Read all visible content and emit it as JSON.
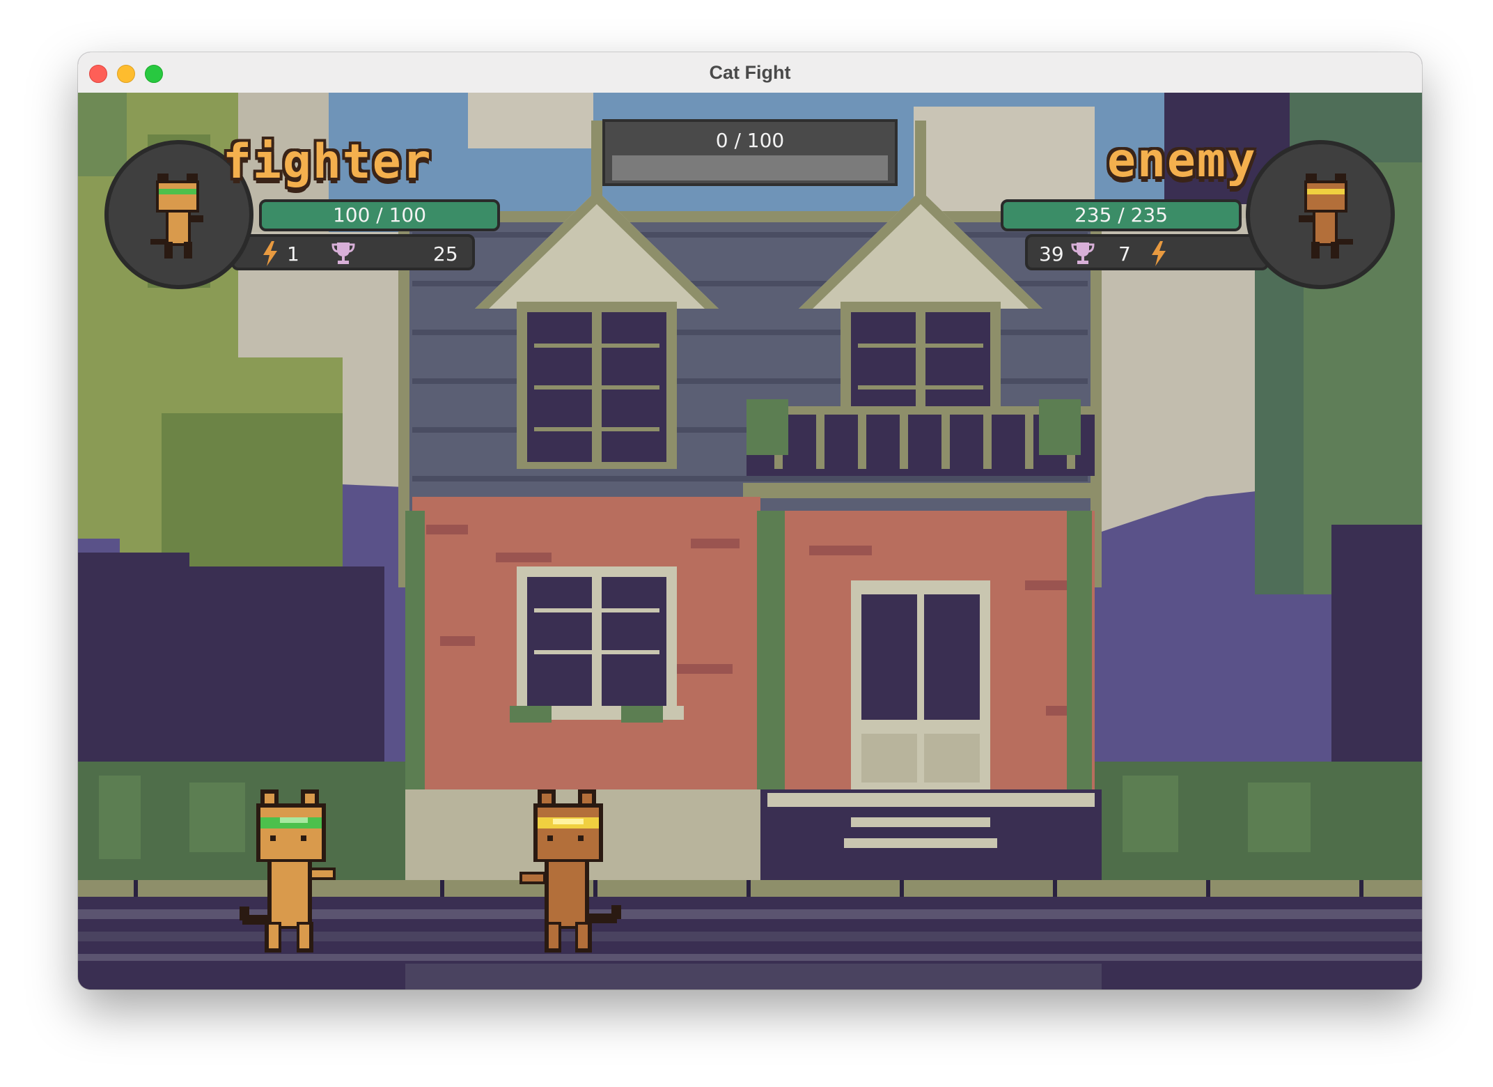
{
  "window": {
    "title": "Cat Fight"
  },
  "round": {
    "text": "0 / 100",
    "progress": 0
  },
  "player": {
    "name": "fighter",
    "health": "100 / 100",
    "energy": "1",
    "trophies": "25",
    "headband_color": "#4cc04c",
    "fur_color": "#d99a4c"
  },
  "enemy": {
    "name": "enemy",
    "health": "235 / 235",
    "energy": "7",
    "trophies": "39",
    "headband_color": "#f0d040",
    "fur_color": "#b36f3a"
  },
  "icons": {
    "energy": "lightning-icon",
    "trophy": "trophy-icon"
  },
  "colors": {
    "health_bar": "#3b8d67",
    "name_text": "#f4b04e",
    "hud_dark": "#3a3a3a"
  }
}
